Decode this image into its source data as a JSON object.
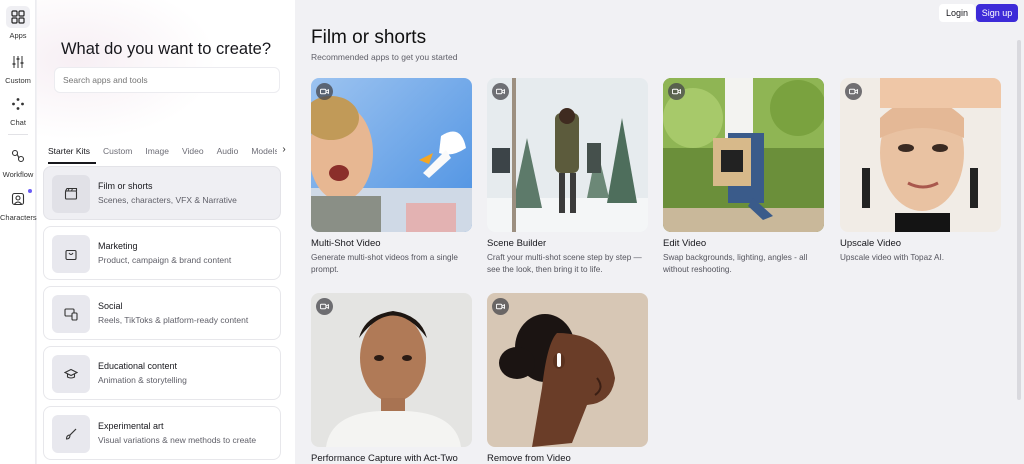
{
  "rail": {
    "items": [
      {
        "label": "Apps",
        "icon": "grid-icon"
      },
      {
        "label": "Custom",
        "icon": "sliders-icon"
      },
      {
        "label": "Chat",
        "icon": "sparkle-icon"
      },
      {
        "label": "Workflow",
        "icon": "workflow-icon"
      },
      {
        "label": "Characters",
        "icon": "character-icon"
      }
    ]
  },
  "panel": {
    "title": "What do you want to create?",
    "search_placeholder": "Search apps and tools",
    "tabs": [
      {
        "label": "Starter Kits"
      },
      {
        "label": "Custom"
      },
      {
        "label": "Image"
      },
      {
        "label": "Video"
      },
      {
        "label": "Audio"
      },
      {
        "label": "Models"
      }
    ],
    "kits": [
      {
        "title": "Film or shorts",
        "subtitle": "Scenes, characters, VFX & Narrative",
        "icon": "clapperboard-icon"
      },
      {
        "title": "Marketing",
        "subtitle": "Product, campaign & brand content",
        "icon": "shopping-bag-icon"
      },
      {
        "title": "Social",
        "subtitle": "Reels, TikToks & platform-ready content",
        "icon": "devices-icon"
      },
      {
        "title": "Educational content",
        "subtitle": "Animation & storytelling",
        "icon": "graduation-cap-icon"
      },
      {
        "title": "Experimental art",
        "subtitle": "Visual variations & new methods to create",
        "icon": "brush-icon"
      }
    ]
  },
  "header": {
    "login": "Login",
    "signup": "Sign up",
    "signup_color": "#3d2bd8"
  },
  "main": {
    "title": "Film or shorts",
    "subtitle": "Recommended apps to get you started",
    "cards": [
      {
        "title": "Multi-Shot Video",
        "description": "Generate multi-shot videos from a single prompt."
      },
      {
        "title": "Scene Builder",
        "description": "Craft your multi-shot scene step by step — see the look, then bring it to life."
      },
      {
        "title": "Edit Video",
        "description": "Swap backgrounds, lighting, angles - all without reshooting."
      },
      {
        "title": "Upscale Video",
        "description": "Upscale video with Topaz AI."
      },
      {
        "title": "Performance Capture with Act-Two",
        "description": ""
      },
      {
        "title": "Remove from Video",
        "description": ""
      }
    ]
  }
}
